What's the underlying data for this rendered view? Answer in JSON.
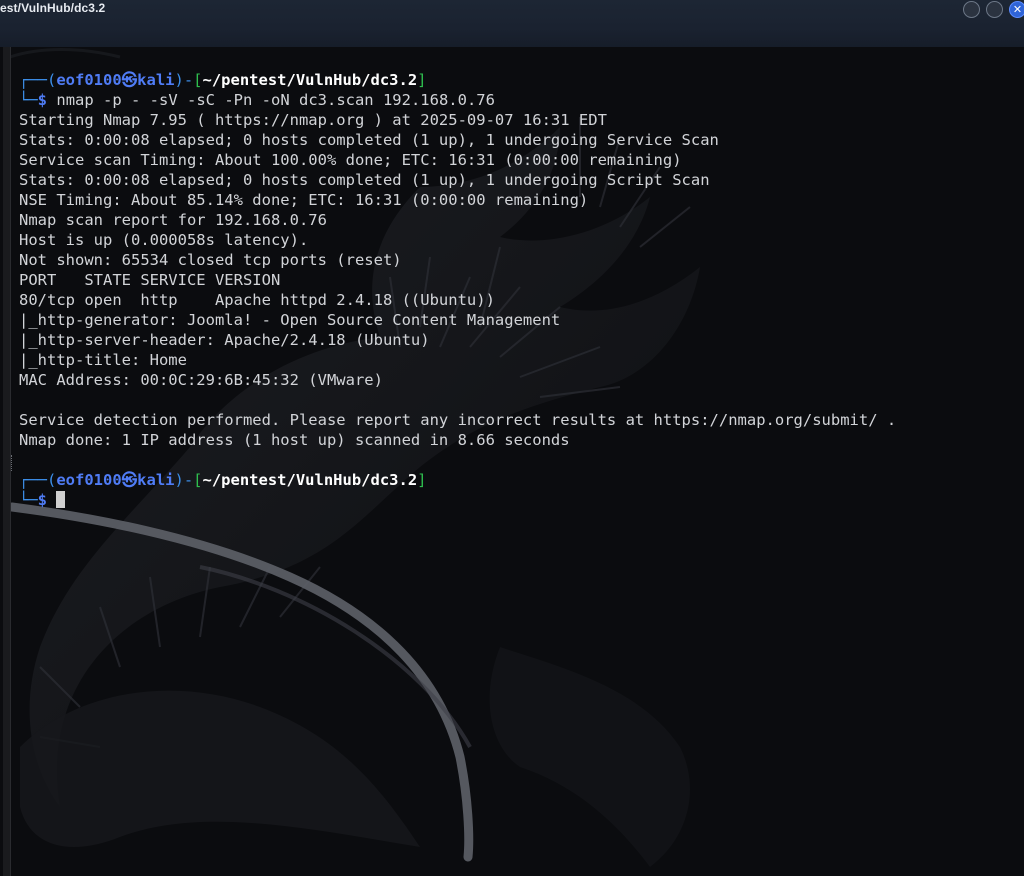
{
  "window": {
    "title": "est/VulnHub/dc3.2",
    "close_glyph": "✕"
  },
  "prompt": {
    "user": "eof0100",
    "at_symbol": "㉿",
    "host": "kali",
    "path": "~/pentest/VulnHub/dc3.2",
    "symbol": "$"
  },
  "session": {
    "command": "nmap -p - -sV -sC -Pn -oN dc3.scan 192.168.0.76",
    "output": [
      "Starting Nmap 7.95 ( https://nmap.org ) at 2025-09-07 16:31 EDT",
      "Stats: 0:00:08 elapsed; 0 hosts completed (1 up), 1 undergoing Service Scan",
      "Service scan Timing: About 100.00% done; ETC: 16:31 (0:00:00 remaining)",
      "Stats: 0:00:08 elapsed; 0 hosts completed (1 up), 1 undergoing Script Scan",
      "NSE Timing: About 85.14% done; ETC: 16:31 (0:00:00 remaining)",
      "Nmap scan report for 192.168.0.76",
      "Host is up (0.000058s latency).",
      "Not shown: 65534 closed tcp ports (reset)",
      "PORT   STATE SERVICE VERSION",
      "80/tcp open  http    Apache httpd 2.4.18 ((Ubuntu))",
      "|_http-generator: Joomla! - Open Source Content Management",
      "|_http-server-header: Apache/2.4.18 (Ubuntu)",
      "|_http-title: Home",
      "MAC Address: 00:0C:29:6B:45:32 (VMware)",
      "",
      "Service detection performed. Please report any incorrect results at https://nmap.org/submit/ .",
      "Nmap done: 1 IP address (1 host up) scanned in 8.66 seconds"
    ]
  },
  "theme": {
    "background": "#0b0c0f",
    "text": "#d2d4d8",
    "prompt_frame": "#3c8ee8",
    "prompt_user": "#4f7cf5",
    "prompt_bracket": "#2fbf4f",
    "prompt_path": "#ffffff",
    "close_button": "#2f64d8"
  },
  "icons": {
    "close": "close-icon",
    "minimize": "minimize-icon",
    "maximize": "maximize-icon",
    "background": "kali-dragon-wallpaper"
  }
}
